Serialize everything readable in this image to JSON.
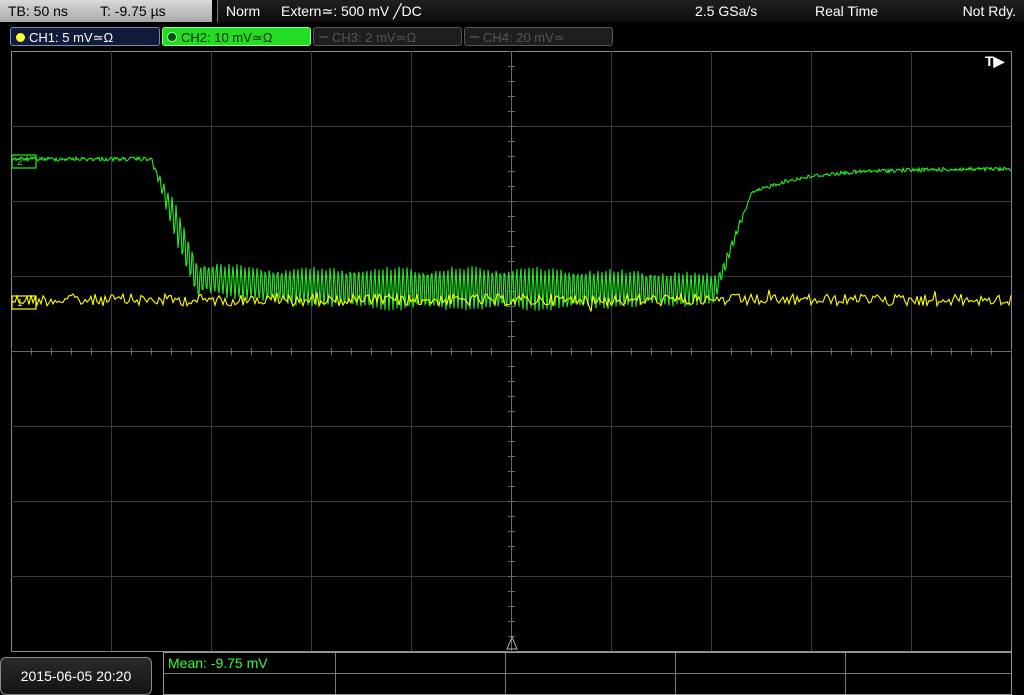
{
  "status_bar": {
    "timebase": "TB: 50 ns",
    "trigger_time": "T: -9.75 µs",
    "mode": "Norm",
    "trigger_source": "Extern≃: 500 mV ╱DC",
    "sample_rate": "2.5 GSa/s",
    "acquisition": "Real Time",
    "state": "Not Rdy."
  },
  "channels": [
    {
      "label": "CH1: 5 mV≃Ω",
      "color": "#ffff33",
      "active": true
    },
    {
      "label": "CH2: 10 mV≃Ω",
      "color": "#22dd22",
      "active": true,
      "selected": true
    },
    {
      "label": "CH3: 2 mV≃Ω",
      "color": "#555555",
      "active": false
    },
    {
      "label": "CH4: 20 mV≃",
      "color": "#555555",
      "active": false
    }
  ],
  "screen": {
    "trigger_marker": "T▶",
    "ch1_marker": "1",
    "ch2_marker": "2"
  },
  "bottom": {
    "datetime": "2015-06-05 20:20",
    "measurement": "Mean: -9.75 mV"
  }
}
